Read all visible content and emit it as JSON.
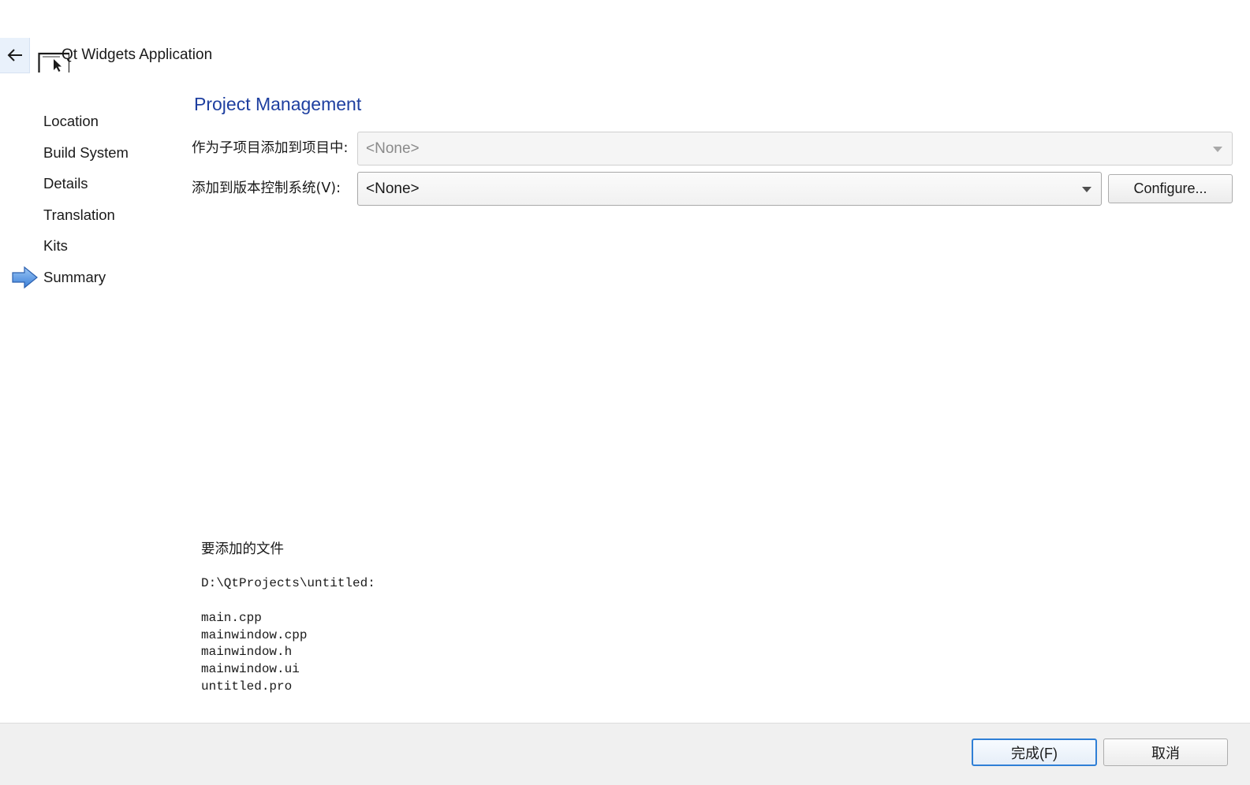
{
  "header": {
    "back_icon": "arrow-left-icon",
    "wizard_icon": "window-cursor-icon",
    "title": "Qt Widgets Application"
  },
  "sidebar": {
    "current_indicator_icon": "blue-arrow-right-icon",
    "current_index": 5,
    "steps": [
      {
        "label": "Location"
      },
      {
        "label": "Build System"
      },
      {
        "label": "Details"
      },
      {
        "label": "Translation"
      },
      {
        "label": "Kits"
      },
      {
        "label": "Summary"
      }
    ]
  },
  "main": {
    "title": "Project Management",
    "subproject": {
      "label": "作为子项目添加到项目中:",
      "value": "<None>",
      "enabled": false
    },
    "vcs": {
      "label": "添加到版本控制系统(V):",
      "value": "<None>",
      "configure_label": "Configure..."
    },
    "files": {
      "heading": "要添加的文件",
      "path": "D:\\QtProjects\\untitled:",
      "list": [
        "main.cpp",
        "mainwindow.cpp",
        "mainwindow.h",
        "mainwindow.ui",
        "untitled.pro"
      ]
    }
  },
  "footer": {
    "finish_label": "完成(F)",
    "cancel_label": "取消"
  },
  "colors": {
    "title_blue": "#1e3fa0",
    "accent_blue": "#2f7fd6",
    "footer_bg": "#f0f0f0"
  }
}
